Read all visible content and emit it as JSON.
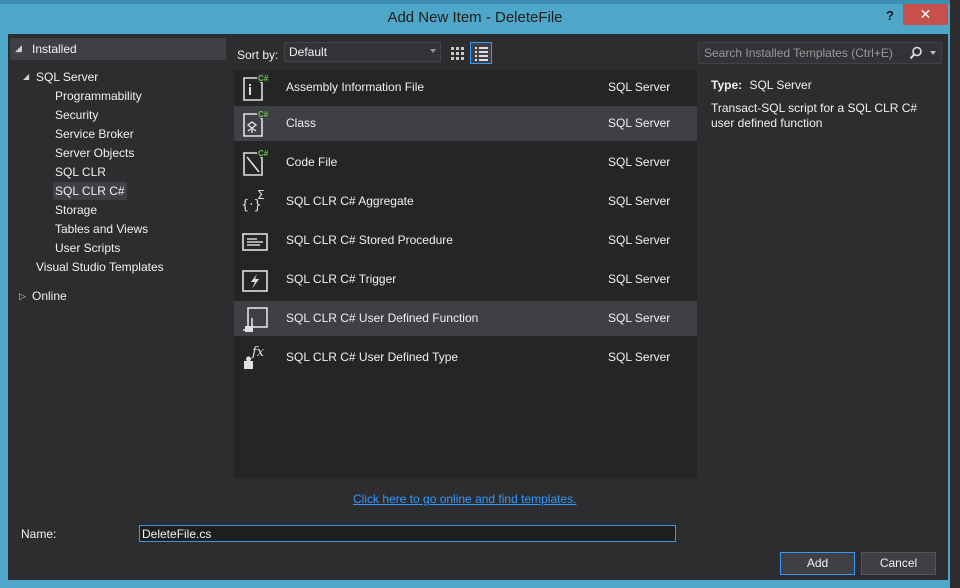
{
  "window": {
    "title": "Add New Item - DeleteFile",
    "help": "?",
    "close": "✕"
  },
  "tree": {
    "installed": "Installed",
    "sql_server": "SQL Server",
    "children": [
      "Programmability",
      "Security",
      "Service Broker",
      "Server Objects",
      "SQL CLR",
      "SQL CLR C#",
      "Storage",
      "Tables and Views",
      "User Scripts"
    ],
    "vs_templates": "Visual Studio Templates",
    "online": "Online"
  },
  "toolbar": {
    "sort_label": "Sort by:",
    "sort_value": "Default",
    "search_placeholder": "Search Installed Templates (Ctrl+E)"
  },
  "templates": [
    {
      "name": "Assembly Information File",
      "category": "SQL Server",
      "icon": "assembly-info-icon"
    },
    {
      "name": "Class",
      "category": "SQL Server",
      "icon": "class-icon"
    },
    {
      "name": "Code File",
      "category": "SQL Server",
      "icon": "code-file-icon"
    },
    {
      "name": "SQL CLR C# Aggregate",
      "category": "SQL Server",
      "icon": "aggregate-icon"
    },
    {
      "name": "SQL CLR C# Stored Procedure",
      "category": "SQL Server",
      "icon": "stored-procedure-icon"
    },
    {
      "name": "SQL CLR C# Trigger",
      "category": "SQL Server",
      "icon": "trigger-icon"
    },
    {
      "name": "SQL CLR C# User Defined Function",
      "category": "SQL Server",
      "icon": "user-defined-function-icon"
    },
    {
      "name": "SQL CLR C# User Defined Type",
      "category": "SQL Server",
      "icon": "user-defined-type-icon"
    }
  ],
  "description": {
    "type_label": "Type:",
    "type_value": "SQL Server",
    "text": "Transact-SQL script for a SQL CLR C# user defined function"
  },
  "online_link": "Click here to go online and find templates.",
  "name_field": {
    "label": "Name:",
    "value": "DeleteFile.cs"
  },
  "buttons": {
    "add": "Add",
    "cancel": "Cancel"
  }
}
